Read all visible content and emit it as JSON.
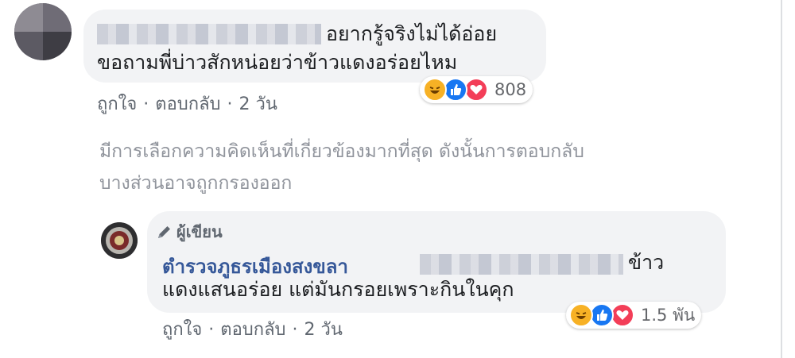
{
  "comment": {
    "text_line1": "อยากรู้จริงไม่ได้อ่อย",
    "text_line2": "ขอถามพี่บ่าวสักหน่อยว่าข้าวแดงอร่อยไหม",
    "reactions": {
      "icons": [
        "haha-icon",
        "like-icon",
        "love-icon"
      ],
      "count": "808"
    },
    "actions": {
      "like_label": "ถูกใจ",
      "reply_label": "ตอบกลับ",
      "time": "2 วัน",
      "separator": "·"
    }
  },
  "filter_notice": {
    "line1": "มีการเลือกความคิดเห็นที่เกี่ยวข้องมากที่สุด ดังนั้นการตอบกลับ",
    "line2": "บางส่วนอาจถูกกรองออก"
  },
  "reply": {
    "badge_label": "ผู้เขียน",
    "author_name": "ตำรวจภูธรเมืองสงขลา",
    "text_line1_tail": "ข้าว",
    "text_line2": "แดงแสนอร่อย แต่มันกรอยเพราะกินในคุก",
    "reactions": {
      "icons": [
        "haha-icon",
        "like-icon",
        "love-icon"
      ],
      "count": "1.5 พัน"
    },
    "actions": {
      "like_label": "ถูกใจ",
      "reply_label": "ตอบกลับ",
      "time": "2 วัน",
      "separator": "·"
    }
  },
  "colors": {
    "bubble": "#f2f3f5",
    "link_blue": "#365899",
    "meta_gray": "#606770",
    "haha": "#f7b125",
    "like": "#1877f2",
    "love": "#f33e58"
  }
}
